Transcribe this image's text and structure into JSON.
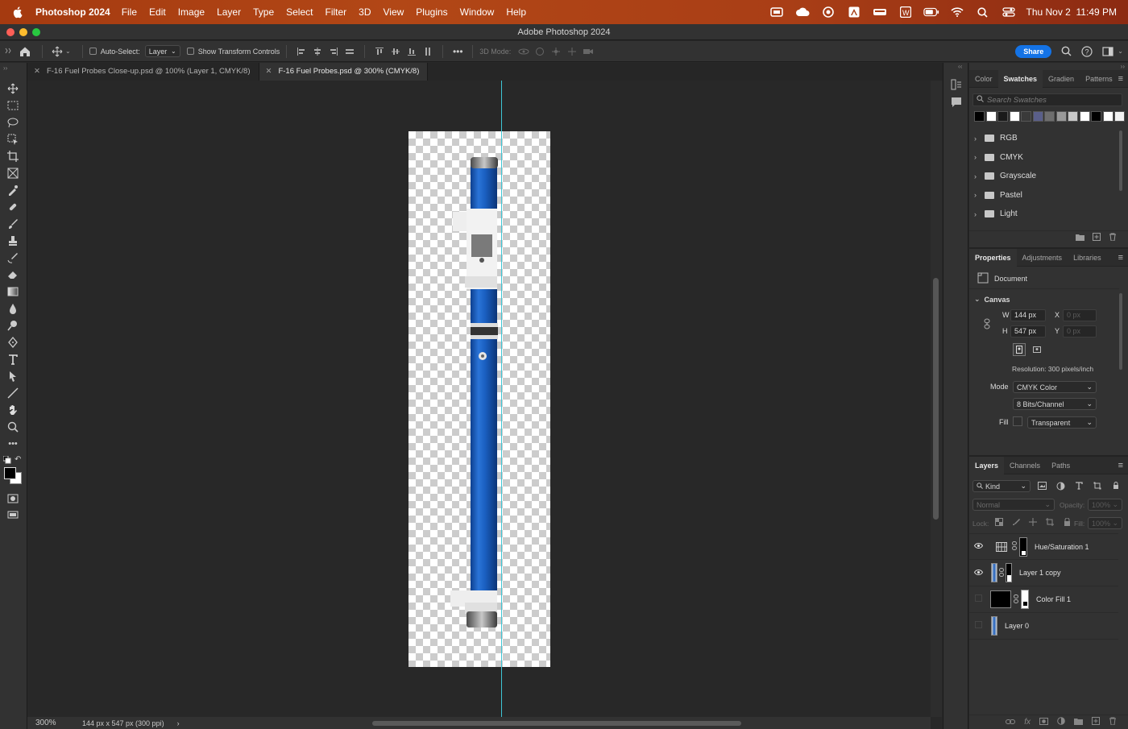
{
  "menubar": {
    "app_name": "Photoshop 2024",
    "items": [
      "File",
      "Edit",
      "Image",
      "Layer",
      "Type",
      "Select",
      "Filter",
      "3D",
      "View",
      "Plugins",
      "Window",
      "Help"
    ],
    "datetime": "Thu Nov 2  11:49 PM"
  },
  "window": {
    "title": "Adobe Photoshop 2024"
  },
  "options": {
    "auto_select_label": "Auto-Select:",
    "auto_select_value": "Layer",
    "show_transform_label": "Show Transform Controls",
    "mode_3d_label": "3D Mode:",
    "share_label": "Share"
  },
  "tabs": [
    {
      "label": "F-16 Fuel Probes Close-up.psd @ 100% (Layer 1, CMYK/8)"
    },
    {
      "label": "F-16 Fuel Probes.psd @ 300% (CMYK/8)"
    }
  ],
  "status": {
    "zoom": "300%",
    "doc_info": "144 px x 547 px (300 ppi)",
    "arrow": "›"
  },
  "swatches_panel": {
    "tabs": [
      "Color",
      "Swatches",
      "Gradien",
      "Patterns"
    ],
    "active_tab": "Swatches",
    "search_placeholder": "Search Swatches",
    "recent_colors": [
      "#000000",
      "#ffffff",
      "#1a1a1a",
      "#ffffff",
      "#3a3a3a",
      "#5a5f8a",
      "#6e6e6e",
      "#9a9a9a",
      "#c8c8c8",
      "#ffffff",
      "#000000",
      "#ffffff",
      "#f2f2f2"
    ],
    "folders": [
      "RGB",
      "CMYK",
      "Grayscale",
      "Pastel",
      "Light"
    ]
  },
  "properties_panel": {
    "tabs": [
      "Properties",
      "Adjustments",
      "Libraries"
    ],
    "active_tab": "Properties",
    "document_label": "Document",
    "canvas_label": "Canvas",
    "w_label": "W",
    "w_value": "144 px",
    "h_label": "H",
    "h_value": "547 px",
    "x_label": "X",
    "x_value": "0 px",
    "y_label": "Y",
    "y_value": "0 px",
    "resolution": "Resolution: 300 pixels/inch",
    "mode_label": "Mode",
    "mode_value": "CMYK Color",
    "bits_value": "8 Bits/Channel",
    "fill_label": "Fill",
    "fill_value": "Transparent"
  },
  "layers_panel": {
    "tabs": [
      "Layers",
      "Channels",
      "Paths"
    ],
    "active_tab": "Layers",
    "kind_label": "Kind",
    "blend_mode": "Normal",
    "opacity_label": "Opacity:",
    "opacity_value": "100%",
    "lock_label": "Lock:",
    "fill_label": "Fill:",
    "fill_value": "100%",
    "layers": [
      {
        "name": "Hue/Saturation 1",
        "visible": true
      },
      {
        "name": "Layer 1 copy",
        "visible": true
      },
      {
        "name": "Color Fill 1",
        "visible": false
      },
      {
        "name": "Layer 0",
        "visible": false
      }
    ]
  },
  "colors": {
    "guide": "#3ec6d6",
    "accent": "#1473e6",
    "probe_blue": "#1a5fc0"
  }
}
